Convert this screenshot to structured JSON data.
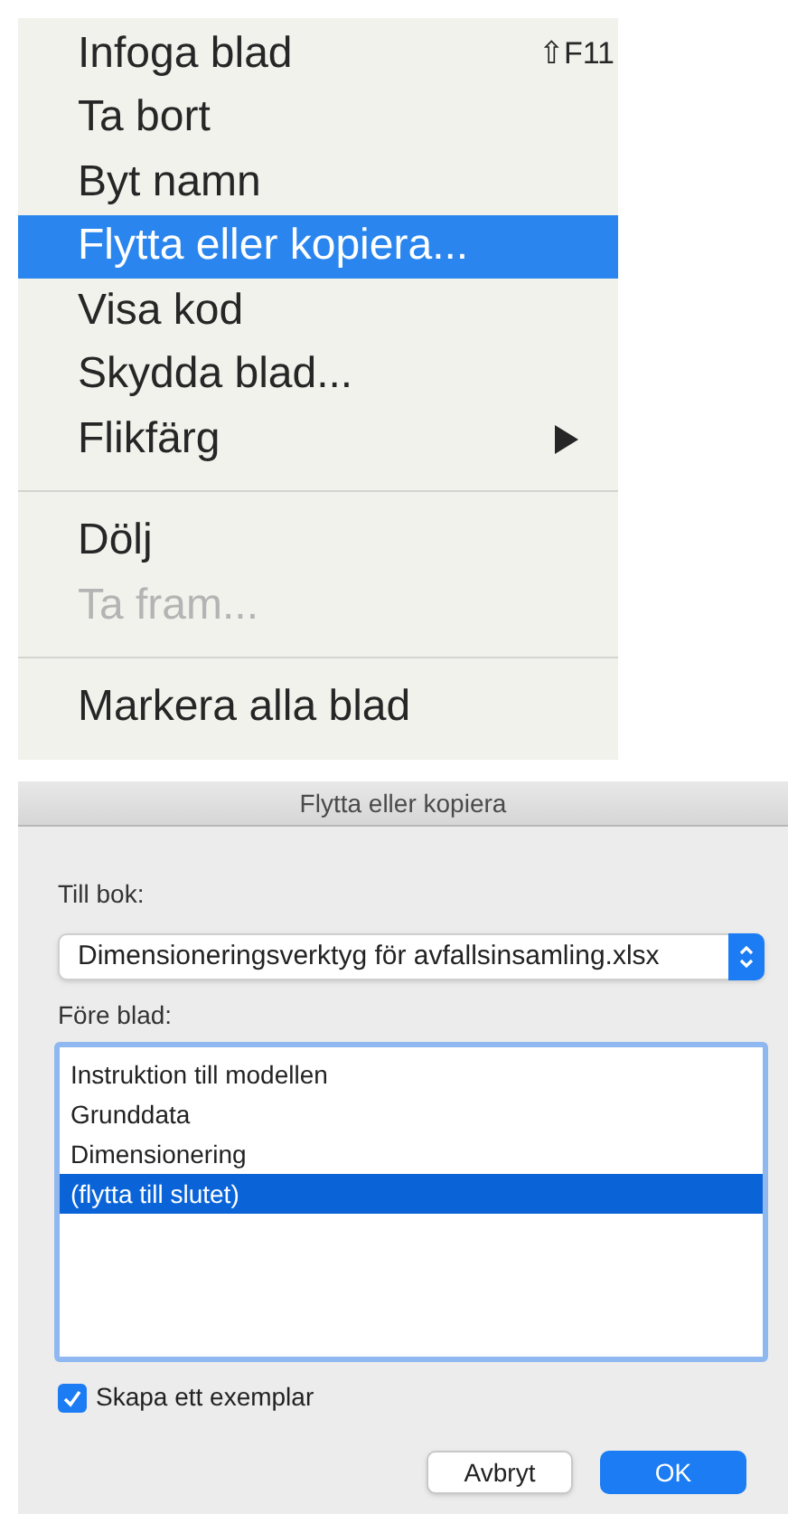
{
  "context_menu": {
    "items": [
      {
        "kind": "item",
        "label": "Infoga blad",
        "shortcut": "⇧F11",
        "selected": false,
        "disabled": false,
        "submenu": false
      },
      {
        "kind": "item",
        "label": "Ta bort",
        "selected": false,
        "disabled": false,
        "submenu": false
      },
      {
        "kind": "item",
        "label": "Byt namn",
        "selected": false,
        "disabled": false,
        "submenu": false
      },
      {
        "kind": "item",
        "label": "Flytta eller kopiera...",
        "selected": true,
        "disabled": false,
        "submenu": false
      },
      {
        "kind": "item",
        "label": "Visa kod",
        "selected": false,
        "disabled": false,
        "submenu": false
      },
      {
        "kind": "item",
        "label": "Skydda blad...",
        "selected": false,
        "disabled": false,
        "submenu": false
      },
      {
        "kind": "item",
        "label": "Flikfärg",
        "selected": false,
        "disabled": false,
        "submenu": true
      },
      {
        "kind": "separator"
      },
      {
        "kind": "item",
        "label": "Dölj",
        "selected": false,
        "disabled": false,
        "submenu": false
      },
      {
        "kind": "item",
        "label": "Ta fram...",
        "selected": false,
        "disabled": true,
        "submenu": false
      },
      {
        "kind": "separator"
      },
      {
        "kind": "item",
        "label": "Markera alla blad",
        "selected": false,
        "disabled": false,
        "submenu": false
      }
    ]
  },
  "dialog": {
    "title": "Flytta eller kopiera",
    "book_label": "Till bok:",
    "book_value": "Dimensioneringsverktyg för avfallsinsamling.xlsx",
    "sheet_label": "Före blad:",
    "sheets": [
      {
        "label": "Instruktion till modellen",
        "selected": false
      },
      {
        "label": "Grunddata",
        "selected": false
      },
      {
        "label": "Dimensionering",
        "selected": false
      },
      {
        "label": "(flytta till slutet)",
        "selected": true
      }
    ],
    "copy_checkbox": {
      "label": "Skapa ett exemplar",
      "checked": true
    },
    "buttons": [
      {
        "label": "Avbryt",
        "kind": "secondary"
      },
      {
        "label": "OK",
        "kind": "primary"
      }
    ]
  }
}
